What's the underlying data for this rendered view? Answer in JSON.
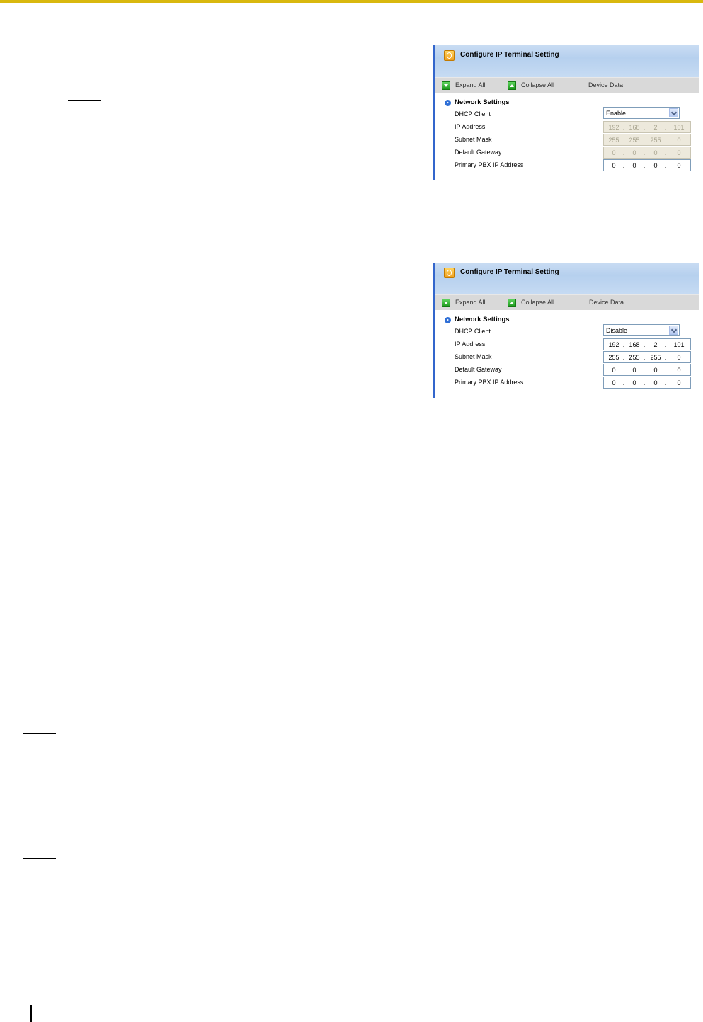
{
  "panels": [
    {
      "title": "Configure IP Terminal Setting",
      "toolbar": {
        "expand_all": "Expand All",
        "collapse_all": "Collapse All",
        "device_data": "Device Data"
      },
      "section_title": "Network Settings",
      "labels": {
        "dhcp_client": "DHCP Client",
        "ip_address": "IP Address",
        "subnet_mask": "Subnet Mask",
        "default_gateway": "Default Gateway",
        "primary_pbx_ip": "Primary PBX IP Address"
      },
      "dhcp_client_value": "Enable",
      "ip_address": [
        "192",
        "168",
        "2",
        "101"
      ],
      "subnet_mask": [
        "255",
        "255",
        "255",
        "0"
      ],
      "default_gateway": [
        "0",
        "0",
        "0",
        "0"
      ],
      "primary_pbx_ip": [
        "0",
        "0",
        "0",
        "0"
      ],
      "separator": "."
    },
    {
      "title": "Configure IP Terminal Setting",
      "toolbar": {
        "expand_all": "Expand All",
        "collapse_all": "Collapse All",
        "device_data": "Device Data"
      },
      "section_title": "Network Settings",
      "labels": {
        "dhcp_client": "DHCP Client",
        "ip_address": "IP Address",
        "subnet_mask": "Subnet Mask",
        "default_gateway": "Default Gateway",
        "primary_pbx_ip": "Primary PBX IP Address"
      },
      "dhcp_client_value": "Disable",
      "ip_address": [
        "192",
        "168",
        "2",
        "101"
      ],
      "subnet_mask": [
        "255",
        "255",
        "255",
        "0"
      ],
      "default_gateway": [
        "0",
        "0",
        "0",
        "0"
      ],
      "primary_pbx_ip": [
        "0",
        "0",
        "0",
        "0"
      ],
      "separator": "."
    }
  ],
  "colors": {
    "top_rule": "#d9b80e",
    "panel_edge": "#3366cc",
    "header_blue": "#c9dcf3",
    "toolbar_gray": "#d9d9d9",
    "disabled_field": "#ede9dc",
    "button_green": "#1d9a1d"
  }
}
